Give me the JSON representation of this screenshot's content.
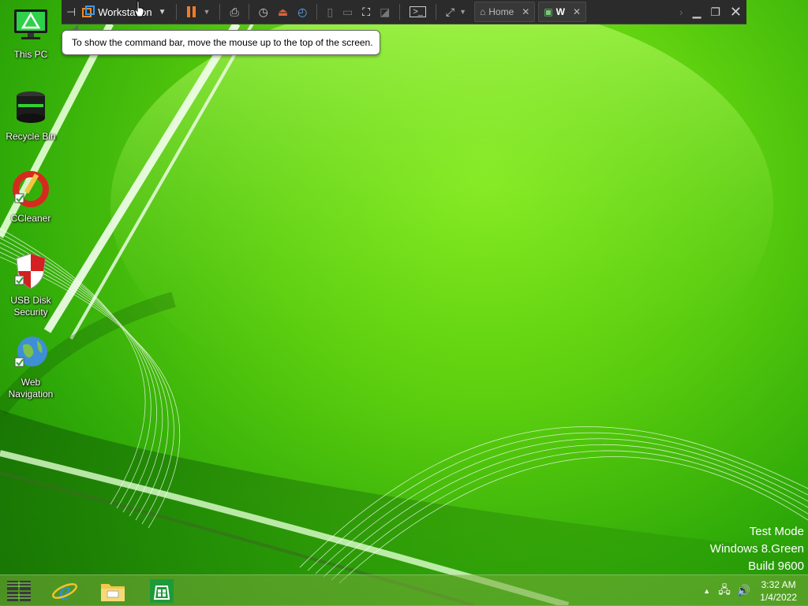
{
  "vm_toolbar": {
    "vm_name": "Workstation",
    "tabs": [
      {
        "label": "Home",
        "active": false
      },
      {
        "label": "W",
        "active": true
      }
    ]
  },
  "tooltip": {
    "text": "To show the command bar, move the mouse up to the top of the screen."
  },
  "desktop_icons": [
    {
      "label": "This PC",
      "icon": "this-pc-icon"
    },
    {
      "label": "Recycle Bin",
      "icon": "recycle-bin-icon"
    },
    {
      "label": "CCleaner",
      "icon": "ccleaner-icon"
    },
    {
      "label": "USB Disk Security",
      "icon": "usb-disk-security-icon"
    },
    {
      "label": "Web Navigation",
      "icon": "web-navigation-icon"
    }
  ],
  "watermark": {
    "line1": "Test Mode",
    "line2": "Windows 8.Green",
    "line3": "Build 9600"
  },
  "taskbar": {
    "apps": [
      "start-icon",
      "internet-explorer-icon",
      "file-explorer-icon",
      "store-icon"
    ],
    "clock_time": "3:32 AM",
    "clock_date": "1/4/2022"
  },
  "colors": {
    "accent_green": "#5fd10f",
    "toolbar_bg": "#2b2b2b",
    "pause_orange": "#f07a2a"
  }
}
